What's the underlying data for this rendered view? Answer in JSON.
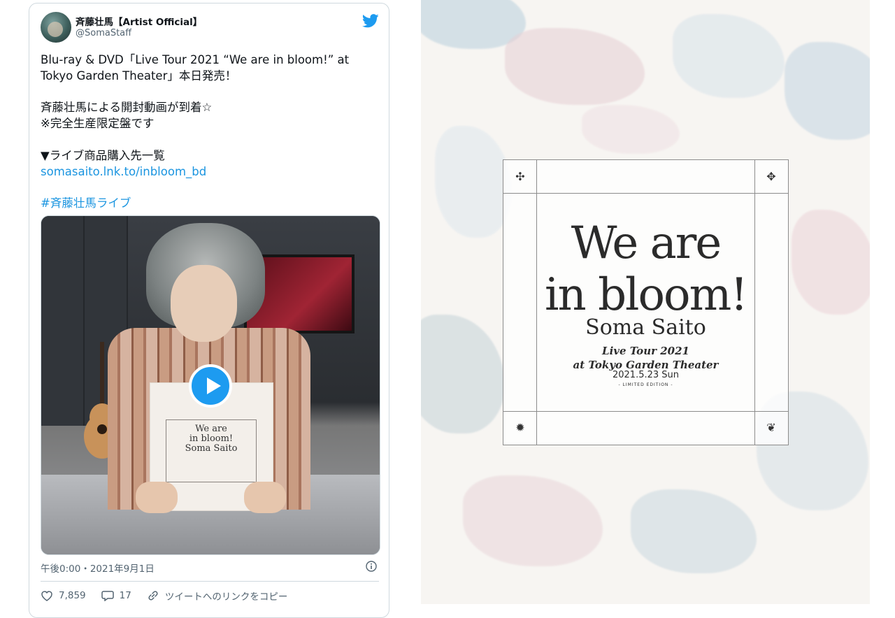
{
  "tweet": {
    "display_name": "斉藤壮馬【Artist Official】",
    "handle": "@SomaStaff",
    "text_lines": "Blu-ray & DVD「Live Tour 2021 “We are in bloom!” at\nTokyo Garden Theater」本日発売！\n\n斉藤壮馬による開封動画が到着☆\n※完全生産限定盤です\n\n▼ライブ商品購入先一覧\n",
    "link": "somasaito.lnk.to/inbloom_bd",
    "hashtag": "#斉藤壮馬ライブ",
    "timestamp": "午後0:00・2021年9月1日",
    "likes": "7,859",
    "replies": "17",
    "copy_link_label": "ツイートへのリンクをコピー",
    "box_title": "We are\nin bloom!\nSoma Saito"
  },
  "cover": {
    "line1": "We are",
    "line2": "in bloom!",
    "artist": "Soma Saito",
    "tour": "Live Tour 2021",
    "venue": "at Tokyo Garden Theater",
    "date": "2021.5.23 Sun",
    "edition": "- LIMITED EDITION -"
  },
  "colors": {
    "accent": "#1d9bf0",
    "link": "#1b95e0",
    "muted": "#536471"
  },
  "icons": [
    "twitter-bird-icon",
    "play-icon",
    "info-icon",
    "heart-icon",
    "reply-icon",
    "link-icon"
  ]
}
